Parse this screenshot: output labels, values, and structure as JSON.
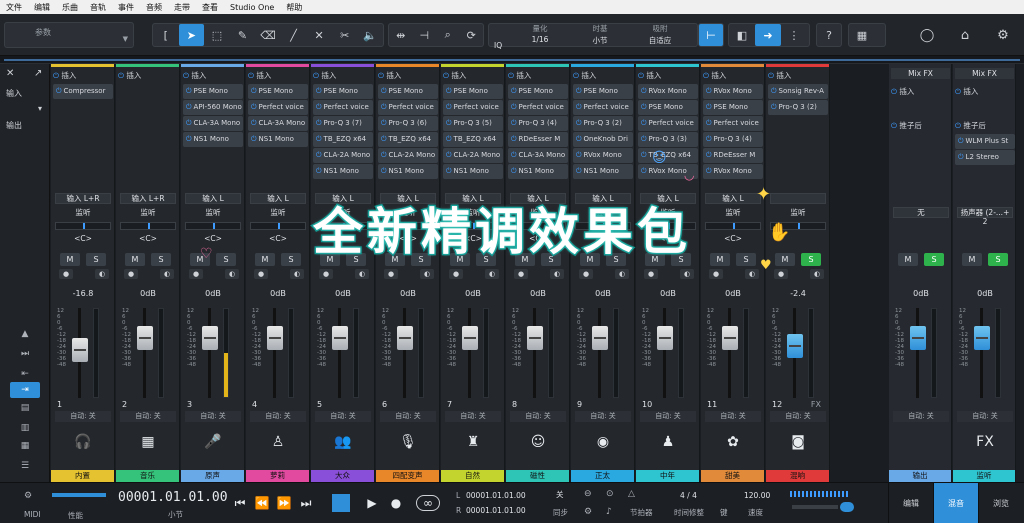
{
  "menu": [
    "文件",
    "编辑",
    "乐曲",
    "音轨",
    "事件",
    "音频",
    "走带",
    "查看",
    "Studio One",
    "帮助"
  ],
  "toolbar": {
    "preset_label": "参数",
    "quantize_label": "量化",
    "quantize_value": "1/16",
    "timebase_label": "时基",
    "timebase_value": "小节",
    "snap_label": "吸附",
    "snap_value": "自适应",
    "iq_label": "IQ",
    "help_label": "?"
  },
  "left_panel": {
    "close": "✕",
    "input_label": "输入",
    "output_label": "输出"
  },
  "insert_label": "插入",
  "channels": [
    {
      "num": "1",
      "name": "内置",
      "color": "#e5c230",
      "fx": [
        "Compressor"
      ],
      "input": "输入 L+R",
      "monitor": "监听",
      "pan": "<C>",
      "vol": "-16.8",
      "fader": 0.55,
      "meter": 0.0,
      "auto": "自动: 关",
      "icon": "🎧",
      "mute": false,
      "solo": false
    },
    {
      "num": "2",
      "name": "音乐",
      "color": "#35c27a",
      "fx": [],
      "input": "输入 L+R",
      "monitor": "监听",
      "pan": "<C>",
      "vol": "0dB",
      "fader": 0.72,
      "meter": 0.0,
      "auto": "自动: 关",
      "icon": "▦",
      "mute": false,
      "solo": false
    },
    {
      "num": "3",
      "name": "原声",
      "color": "#6aa9e8",
      "fx": [
        "PSE Mono",
        "API-560 Mono",
        "CLA-3A Mono",
        "NS1 Mono"
      ],
      "input": "输入 L",
      "monitor": "监听",
      "pan": "<C>",
      "vol": "0dB",
      "fader": 0.72,
      "meter": 0.5,
      "auto": "自动: 关",
      "icon": "🎤",
      "mute": false,
      "solo": false
    },
    {
      "num": "4",
      "name": "萝莉",
      "color": "#e24aa0",
      "fx": [
        "PSE Mono",
        "Perfect voice",
        "CLA-3A Mono",
        "NS1 Mono"
      ],
      "input": "输入 L",
      "monitor": "监听",
      "pan": "<C>",
      "vol": "0dB",
      "fader": 0.72,
      "meter": 0.0,
      "auto": "自动: 关",
      "icon": "♙",
      "mute": false,
      "solo": false
    },
    {
      "num": "5",
      "name": "大众",
      "color": "#8a4fd8",
      "fx": [
        "PSE Mono",
        "Perfect voice",
        "Pro-Q 3 (7)",
        "TB_EZQ x64",
        "CLA-2A Mono",
        "NS1 Mono"
      ],
      "input": "输入 L",
      "monitor": "监听",
      "pan": "<C>",
      "vol": "0dB",
      "fader": 0.72,
      "meter": 0.0,
      "auto": "自动: 关",
      "icon": "👥",
      "mute": false,
      "solo": false
    },
    {
      "num": "6",
      "name": "四配变声",
      "color": "#e8862a",
      "fx": [
        "PSE Mono",
        "Perfect voice",
        "Pro-Q 3 (6)",
        "TB_EZQ x64",
        "CLA-2A Mono",
        "NS1 Mono"
      ],
      "input": "输入 L",
      "monitor": "监听",
      "pan": "<C>",
      "vol": "0dB",
      "fader": 0.72,
      "meter": 0.0,
      "auto": "自动: 关",
      "icon": "🎙",
      "mute": false,
      "solo": false
    },
    {
      "num": "7",
      "name": "自然",
      "color": "#c4d42e",
      "fx": [
        "PSE Mono",
        "Perfect voice",
        "Pro-Q 3 (5)",
        "TB_EZQ x64",
        "CLA-2A Mono",
        "NS1 Mono"
      ],
      "input": "输入 L",
      "monitor": "监听",
      "pan": "<C>",
      "vol": "0dB",
      "fader": 0.72,
      "meter": 0.0,
      "auto": "自动: 关",
      "icon": "♜",
      "mute": false,
      "solo": false
    },
    {
      "num": "8",
      "name": "磁性",
      "color": "#2ec4b6",
      "fx": [
        "PSE Mono",
        "Perfect voice",
        "Pro-Q 3 (4)",
        "RDeEsser M",
        "CLA-3A Mono",
        "NS1 Mono"
      ],
      "input": "输入 L",
      "monitor": "监听",
      "pan": "<C>",
      "vol": "0dB",
      "fader": 0.72,
      "meter": 0.0,
      "auto": "自动: 关",
      "icon": "☺",
      "mute": false,
      "solo": false
    },
    {
      "num": "9",
      "name": "正太",
      "color": "#2aa8e0",
      "fx": [
        "PSE Mono",
        "Perfect voice",
        "Pro-Q 3 (2)",
        "OneKnob Dri",
        "RVox Mono",
        "NS1 Mono"
      ],
      "input": "输入 L",
      "monitor": "监听",
      "pan": "<C>",
      "vol": "0dB",
      "fader": 0.72,
      "meter": 0.0,
      "auto": "自动: 关",
      "icon": "◉",
      "mute": false,
      "solo": false
    },
    {
      "num": "10",
      "name": "中年",
      "color": "#2ec4d0",
      "fx": [
        "RVox Mono",
        "PSE Mono",
        "Perfect voice",
        "Pro-Q 3 (3)",
        "TB_EZQ x64",
        "RVox Mono"
      ],
      "input": "输入 L",
      "monitor": "监听",
      "pan": "<C>",
      "vol": "0dB",
      "fader": 0.72,
      "meter": 0.0,
      "auto": "自动: 关",
      "icon": "♟",
      "mute": false,
      "solo": false
    },
    {
      "num": "11",
      "name": "甜美",
      "color": "#e08a3a",
      "fx": [
        "RVox Mono",
        "PSE Mono",
        "Perfect voice",
        "Pro-Q 3 (4)",
        "RDeEsser M",
        "RVox Mono"
      ],
      "input": "输入 L",
      "monitor": "监听",
      "pan": "<C>",
      "vol": "0dB",
      "fader": 0.72,
      "meter": 0.0,
      "auto": "自动: 关",
      "icon": "✿",
      "mute": false,
      "solo": false
    },
    {
      "num": "12",
      "name": "混响",
      "color": "#e03a3a",
      "fx": [
        "Sonsig Rev-A",
        "Pro-Q 3 (2)"
      ],
      "input": "",
      "monitor": "监听",
      "pan": "",
      "vol": "-2.4",
      "fader": 0.6,
      "meter": 0.0,
      "auto": "自动: 关",
      "icon": "◙",
      "mute": false,
      "solo": true,
      "fx_label": "FX"
    }
  ],
  "busses": [
    {
      "hdr": "Mix FX",
      "fx": [],
      "post_label": "推子后",
      "send": "无",
      "vol": "0dB",
      "name": "输出",
      "name_color": "#6aa9e8",
      "auto": "自动: 关",
      "fader": 0.72
    },
    {
      "hdr": "Mix FX",
      "fx": [
        "WLM Plus St",
        "L2 Stereo"
      ],
      "post_label": "推子后",
      "send": "扬声器 (2-...+ 2",
      "vol": "0dB",
      "name": "监听",
      "name_color": "#2ec4d0",
      "auto": "自动: 关",
      "fader": 0.72,
      "fx_icon": "FX"
    }
  ],
  "transport": {
    "midi_label": "MIDI",
    "perf_label": "性能",
    "time": "00001.01.01.00",
    "time_unit": "小节",
    "loop_l": "00001.01.01.00",
    "loop_r": "00001.01.01.00",
    "sync_value": "关",
    "sync_label": "同步",
    "metronome_label": "节拍器",
    "timesig": "4 / 4",
    "timesig_label": "时间修整",
    "key_label": "键",
    "tempo": "120.00",
    "tempo_label": "速度",
    "tabs": [
      "编辑",
      "混音",
      "浏览"
    ],
    "active_tab": 1
  },
  "overlay": {
    "title": "全新精调效果包"
  }
}
